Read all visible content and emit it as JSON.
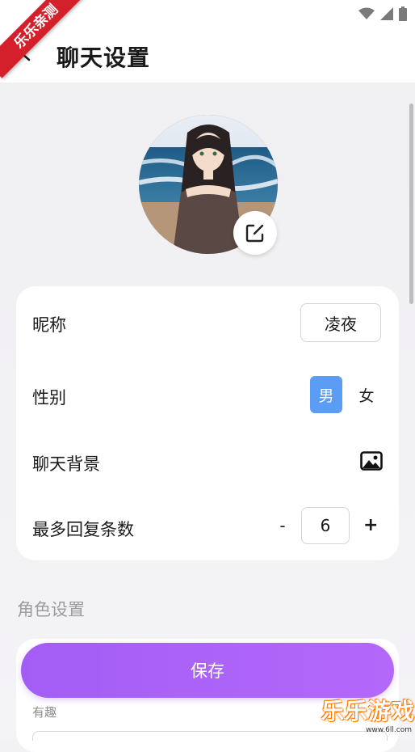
{
  "status": {
    "icons": [
      "wifi-icon",
      "signal-icon",
      "battery-icon"
    ]
  },
  "ribbon": {
    "text": "乐乐亲测"
  },
  "header": {
    "title": "聊天设置",
    "back_icon": "back-arrow-icon"
  },
  "profile": {
    "avatar_icon": "avatar-image",
    "edit_icon": "edit-icon"
  },
  "settings": {
    "nickname_label": "昵称",
    "nickname_value": "凌夜",
    "gender_label": "性别",
    "gender_male": "男",
    "gender_female": "女",
    "background_label": "聊天背景",
    "background_icon": "image-icon",
    "max_replies_label": "最多回复条数",
    "max_replies_minus": "-",
    "max_replies_value": "6",
    "max_replies_plus": "+"
  },
  "role": {
    "section_title": "角色设置",
    "partial_label": "有趣"
  },
  "actions": {
    "save_label": "保存"
  },
  "watermark": {
    "text": "乐乐游戏",
    "url": "www.6ll.com"
  },
  "colors": {
    "accent_purple": "#a35df5",
    "selected_blue": "#5b9cf5",
    "ribbon_red": "#d3202a"
  }
}
